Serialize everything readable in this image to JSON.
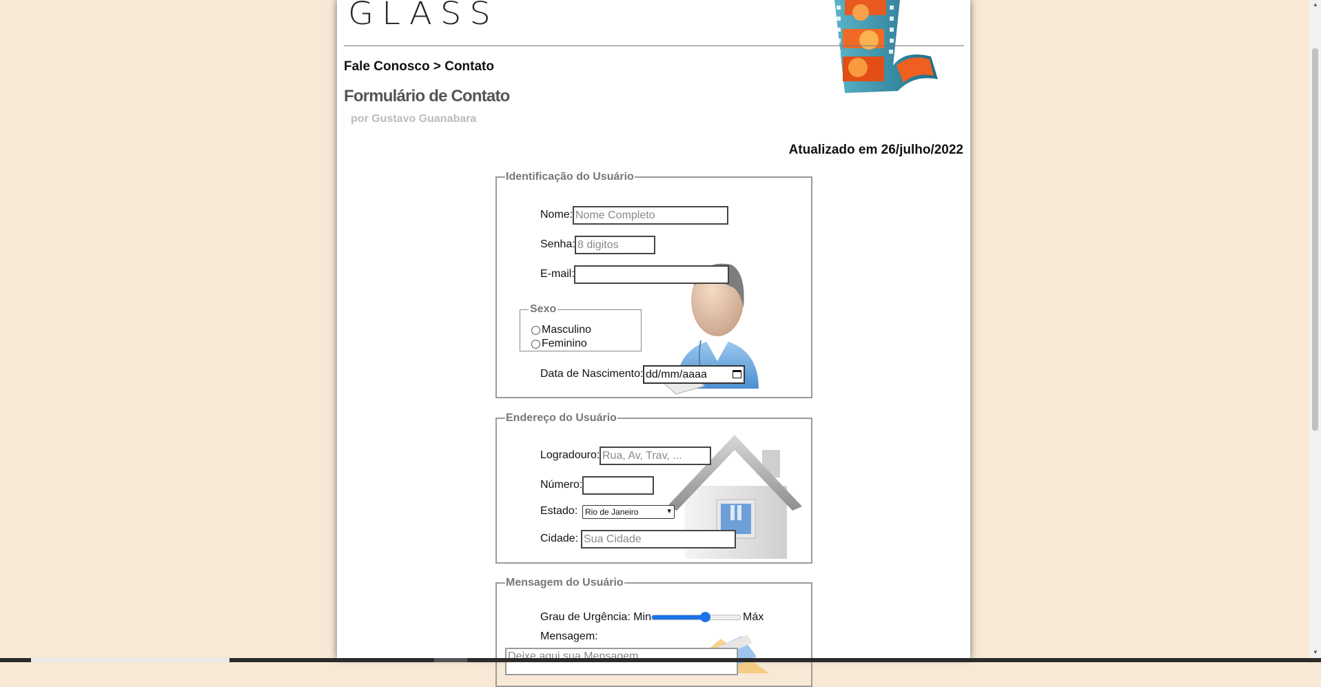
{
  "header": {
    "logo_text": "GLASS",
    "breadcrumb": "Fale Conosco > Contato",
    "form_title": "Formulário de Contato",
    "form_author": "por Gustavo Guanabara",
    "updated": "Atualizado em 26/julho/2022"
  },
  "identificacao": {
    "legend": "Identificação do Usuário",
    "nome_label": "Nome:",
    "nome_placeholder": "Nome Completo",
    "senha_label": "Senha:",
    "senha_placeholder": "8 digitos",
    "email_label": "E-mail:",
    "sexo_legend": "Sexo",
    "sexo_options": [
      "Masculino",
      "Feminino"
    ],
    "nascimento_label": "Data de Nascimento:",
    "nascimento_value": "dd/mm/aaaa"
  },
  "endereco": {
    "legend": "Endereço do Usuário",
    "logradouro_label": "Logradouro:",
    "logradouro_placeholder": "Rua, Av, Trav, ...",
    "numero_label": "Número:",
    "estado_label": "Estado:",
    "estado_selected": "Rio de Janeiro",
    "cidade_label": "Cidade:",
    "cidade_placeholder": "Sua Cidade"
  },
  "mensagem": {
    "legend": "Mensagem do Usuário",
    "urgencia_label": "Grau de Urgência: Min",
    "urgencia_max": "Máx",
    "urgencia_level": 0.6,
    "mensagem_label": "Mensagem:",
    "mensagem_placeholder": "Deixe aqui sua Mensagem"
  },
  "colors": {
    "page_background": "#f8e8d6",
    "legend_gray": "#777777",
    "slider_accent": "#1a73e8"
  },
  "icons": [
    "film-strip-icon",
    "user-avatar-icon",
    "house-icon",
    "envelope-icon",
    "calendar-icon"
  ]
}
